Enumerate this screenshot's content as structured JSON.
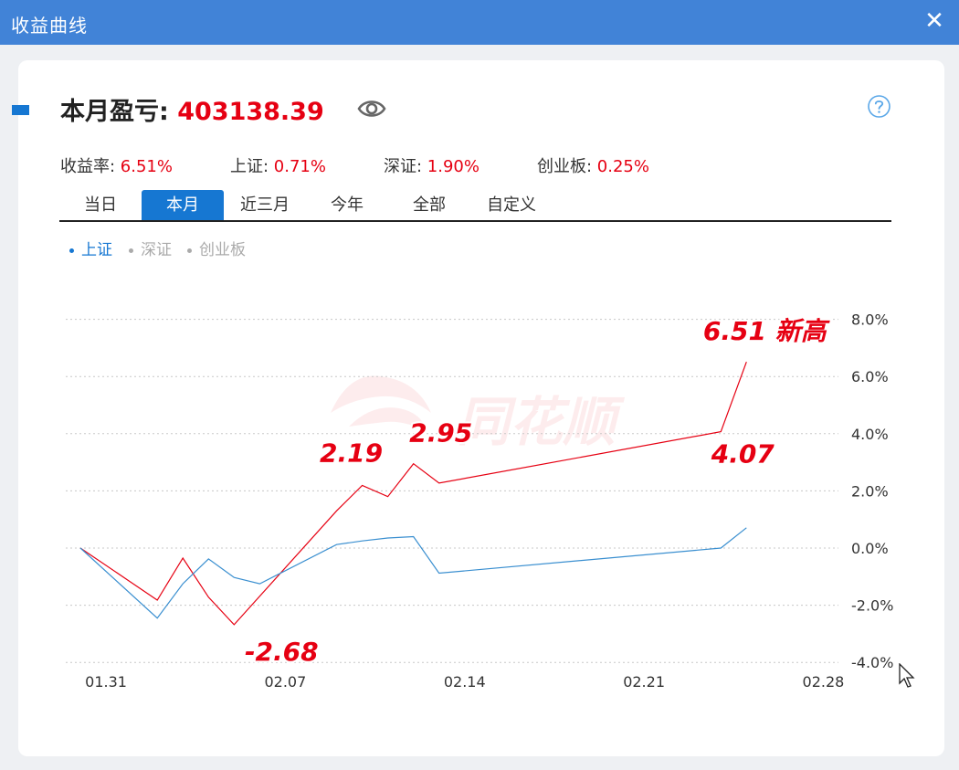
{
  "window": {
    "title": "收益曲线"
  },
  "header": {
    "pnl_label": "本月盈亏: ",
    "pnl_value": "403138.39"
  },
  "stats": [
    {
      "label": "收益率: ",
      "value": "6.51%"
    },
    {
      "label": "上证: ",
      "value": "0.71%"
    },
    {
      "label": "深证: ",
      "value": "1.90%"
    },
    {
      "label": "创业板: ",
      "value": "0.25%"
    }
  ],
  "tabs": [
    {
      "label": "当日"
    },
    {
      "label": "本月",
      "active": true
    },
    {
      "label": "近三月"
    },
    {
      "label": "今年"
    },
    {
      "label": "全部"
    },
    {
      "label": "自定义"
    }
  ],
  "legend": [
    {
      "label": "上证",
      "active": true
    },
    {
      "label": "深证",
      "active": false
    },
    {
      "label": "创业板",
      "active": false
    }
  ],
  "colors": {
    "accent": "#1677d2",
    "profit_red": "#e60012",
    "index_line": "#3a8fd0",
    "legend_inactive": "#aaaaaa",
    "title_bar": "#4183d7"
  },
  "watermark": "同花顺",
  "chart_data": {
    "type": "line",
    "x_ticks": [
      "01.31",
      "02.07",
      "02.14",
      "02.21",
      "02.28"
    ],
    "y_ticks": [
      "8.0%",
      "6.0%",
      "4.0%",
      "2.0%",
      "0.0%",
      "-2.0%",
      "-4.0%"
    ],
    "ylim": [
      -4,
      8
    ],
    "grid": true,
    "series": [
      {
        "role": "portfolio",
        "x": [
          "01.30",
          "02.02",
          "02.03",
          "02.04",
          "02.05",
          "02.09",
          "02.10",
          "02.11",
          "02.12",
          "02.13",
          "02.24",
          "02.25"
        ],
        "values": [
          0.0,
          -1.82,
          -0.35,
          -1.72,
          -2.68,
          1.3,
          2.19,
          1.8,
          2.95,
          2.27,
          4.07,
          6.51
        ]
      },
      {
        "name": "上证",
        "x": [
          "01.30",
          "02.02",
          "02.03",
          "02.04",
          "02.05",
          "02.06",
          "02.09",
          "02.10",
          "02.11",
          "02.12",
          "02.13",
          "02.24",
          "02.25"
        ],
        "values": [
          0.0,
          -2.45,
          -1.25,
          -0.38,
          -1.03,
          -1.25,
          0.12,
          0.25,
          0.35,
          0.4,
          -0.88,
          0.0,
          0.71
        ]
      }
    ],
    "annotations": [
      {
        "text": "-2.68"
      },
      {
        "text": "2.19"
      },
      {
        "text": "2.95"
      },
      {
        "text": "4.07"
      },
      {
        "text": "6.51 新高"
      }
    ]
  }
}
